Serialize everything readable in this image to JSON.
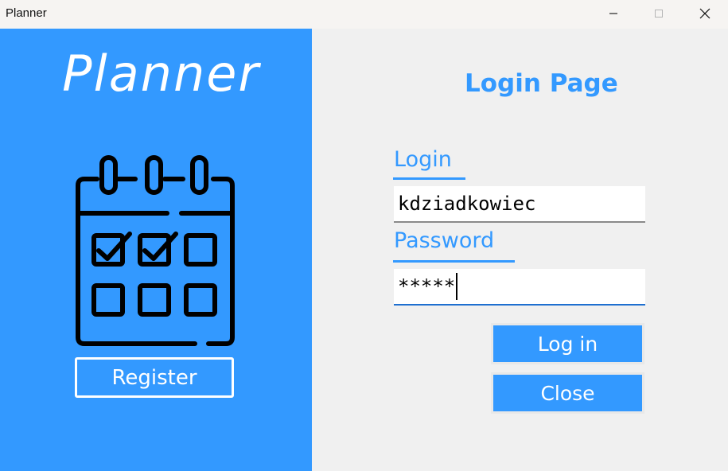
{
  "window": {
    "title": "Planner",
    "controls": [
      "minimize-icon",
      "maximize-icon",
      "close-icon"
    ]
  },
  "brand": {
    "app_name": "Planner",
    "icon": "calendar-checklist-icon",
    "register_label": "Register"
  },
  "login_panel": {
    "page_title": "Login Page",
    "login_label": "Login",
    "login_value": "kdziadkowiec",
    "password_label": "Password",
    "password_value": "*****",
    "login_button": "Log in",
    "close_button": "Close"
  },
  "colors": {
    "accent": "#3399ff",
    "panel_bg": "#f0f0f0",
    "text_on_accent": "#ffffff"
  }
}
